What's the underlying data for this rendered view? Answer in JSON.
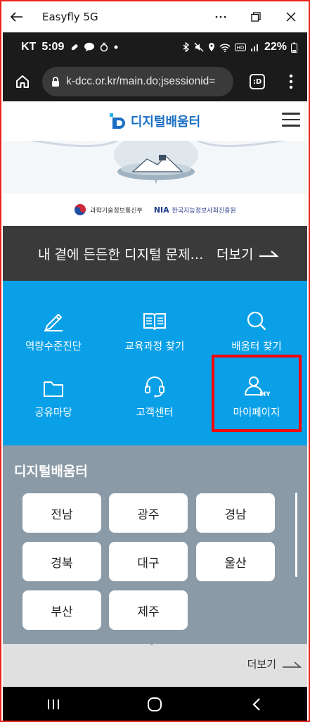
{
  "window": {
    "title": "Easyfly 5G",
    "icons": [
      "back-arrow-icon",
      "more-icon",
      "restore-icon",
      "close-icon"
    ]
  },
  "statusbar": {
    "carrier": "KT",
    "time": "5:09",
    "battery": "22%"
  },
  "browser": {
    "url": "k-dcc.or.kr/main.do;jsessionid=",
    "tab_label": ":D"
  },
  "site": {
    "logo_text": "디지털배움터",
    "ministry": "과학기술정보통신부",
    "nia_mark": "NIA",
    "nia_name": "한국지능정보사회진흥원"
  },
  "notice": {
    "text": "내 곁에 든든한 디지털 문제…",
    "more": "더보기"
  },
  "quickmenu": {
    "items": [
      {
        "label": "역량수준진단",
        "icon": "pencil-icon"
      },
      {
        "label": "교육과정 찾기",
        "icon": "book-icon"
      },
      {
        "label": "배움터 찾기",
        "icon": "search-icon"
      },
      {
        "label": "공유마당",
        "icon": "folder-icon"
      },
      {
        "label": "고객센터",
        "icon": "headset-icon"
      },
      {
        "label": "마이페이지",
        "icon": "my-user-icon"
      }
    ],
    "my_badge": "MY"
  },
  "centers": {
    "title": "디지털배움터",
    "regions": [
      "전남",
      "광주",
      "경남",
      "경북",
      "대구",
      "울산",
      "부산",
      "제주"
    ],
    "more": "더보기"
  },
  "colors": {
    "accent_blue": "#0aa0e8",
    "notice_bg": "#3a3a3a",
    "centers_bg": "#8a9aa6",
    "highlight": "#ff0000"
  }
}
